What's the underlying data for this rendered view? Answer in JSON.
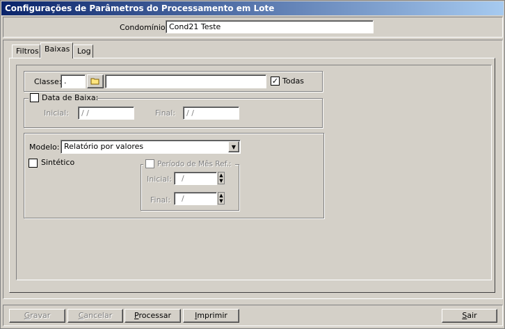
{
  "window": {
    "title": "Configurações de Parâmetros do Processamento em Lote"
  },
  "header": {
    "condominio_label": "Condomínio:",
    "condominio_value": "Cond21 Teste"
  },
  "tabs": [
    {
      "label": "Filtros"
    },
    {
      "label": "Baixas"
    },
    {
      "label": "Log"
    }
  ],
  "classe": {
    "label": "Classe:",
    "code": ".",
    "description": "",
    "todas_label": "Todas",
    "todas_checked": "✓"
  },
  "data_baixa": {
    "label": "Data de Baixa:",
    "inicial_label": "Inicial:",
    "inicial_value": "/ /",
    "final_label": "Final:",
    "final_value": "/ /"
  },
  "modelo": {
    "label": "Modelo:",
    "value": "Relatório por valores",
    "sintetico_label": "Sintético"
  },
  "periodo": {
    "label": "Período de Mês Ref.:",
    "inicial_label": "Inicial:",
    "inicial_value": "/",
    "final_label": "Final:",
    "final_value": "/"
  },
  "buttons": {
    "gravar_u": "G",
    "gravar_rest": "ravar",
    "cancelar_u": "C",
    "cancelar_rest": "ancelar",
    "processar_u": "P",
    "processar_rest": "rocessar",
    "imprimir_u": "I",
    "imprimir_rest": "mprimir",
    "sair_u": "S",
    "sair_rest": "air"
  }
}
